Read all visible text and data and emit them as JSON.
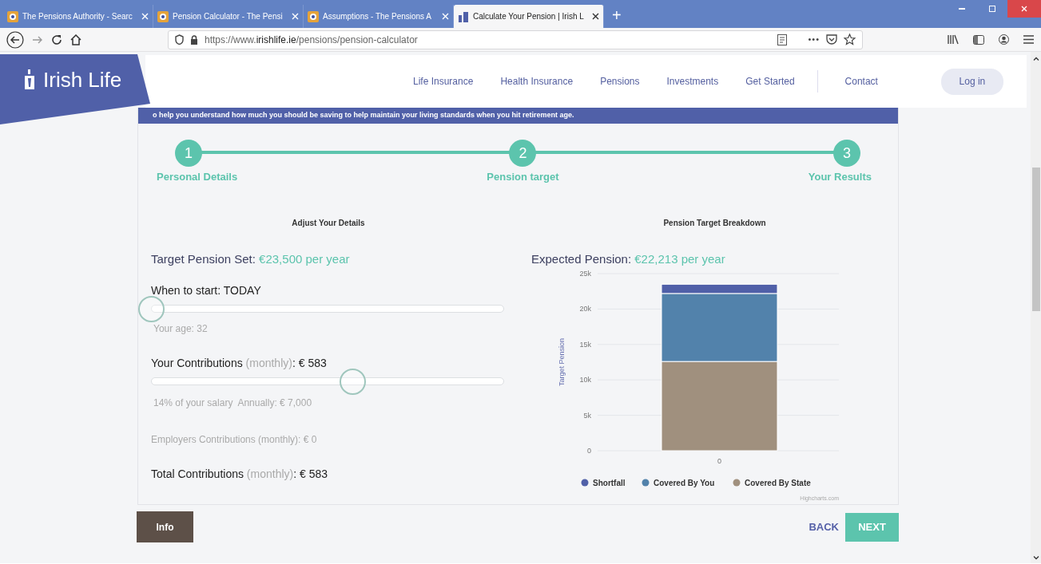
{
  "browser": {
    "tabs": [
      {
        "title": "The Pensions Authority - Searc",
        "selected": false
      },
      {
        "title": "Pension Calculator - The Pensi",
        "selected": false
      },
      {
        "title": "Assumptions - The Pensions A",
        "selected": false
      },
      {
        "title": "Calculate Your Pension | Irish L",
        "selected": true
      }
    ],
    "new_tab": "+",
    "url": "https://www.**irishlife.ie**/pensions/pension-calculator",
    "more": "•••"
  },
  "site": {
    "logo": "Irish Life",
    "nav": [
      {
        "label": "Life Insurance"
      },
      {
        "label": "Health Insurance"
      },
      {
        "label": "Pensions"
      },
      {
        "label": "Investments"
      },
      {
        "label": "Get Started"
      }
    ],
    "contact": "Contact",
    "login": "Log in"
  },
  "banner": "o help you understand how much you should be saving to help maintain your living standards when you hit retirement age.",
  "steps": [
    {
      "number": "1",
      "label": "Personal Details"
    },
    {
      "number": "2",
      "label": "Pension target"
    },
    {
      "number": "3",
      "label": "Your Results"
    }
  ],
  "details": {
    "heading": "Adjust Your Details",
    "target": {
      "label": "Target Pension Set:",
      "value": "€23,500 per year"
    },
    "start": {
      "label": "When to start:",
      "value": "TODAY",
      "level": 0
    },
    "age": "Your age: 32",
    "contributions": {
      "label": "Your Contributions",
      "qualifier": "(monthly)",
      "value": ":  € 583",
      "level": 0.57
    },
    "salary_note": "14% of your salary  Annually: € 7,000",
    "employer": "Employers Contributions (monthly): € 0",
    "total": {
      "label": "Total Contributions",
      "qualifier": "(monthly)",
      "value": ": € 583"
    }
  },
  "breakdown": {
    "heading": "Pension Target Breakdown",
    "expected": {
      "label": "Expected Pension:",
      "value": "€22,213 per year"
    },
    "chart_data": {
      "type": "bar",
      "stacked": true,
      "grid": true,
      "legend": "bottom",
      "ylabel": "Target Pension",
      "categories": [
        "0"
      ],
      "series": [
        {
          "name": "Shortfall",
          "color": "#5060a8",
          "values": [
            1300
          ]
        },
        {
          "name": "Covered By You",
          "color": "#5282ab",
          "values": [
            9600
          ]
        },
        {
          "name": "Covered By State",
          "color": "#a0907e",
          "values": [
            12600
          ]
        }
      ],
      "ylim": [
        0,
        25000
      ],
      "yticks": [
        {
          "value": 0,
          "label": "0"
        },
        {
          "value": 5000,
          "label": "5k"
        },
        {
          "value": 10000,
          "label": "10k"
        },
        {
          "value": 15000,
          "label": "15k"
        },
        {
          "value": 20000,
          "label": "20k"
        },
        {
          "value": 25000,
          "label": "25k"
        }
      ]
    },
    "credit": "Highcharts.com"
  },
  "buttons": {
    "info": "Info",
    "back": "BACK",
    "next": "NEXT"
  }
}
